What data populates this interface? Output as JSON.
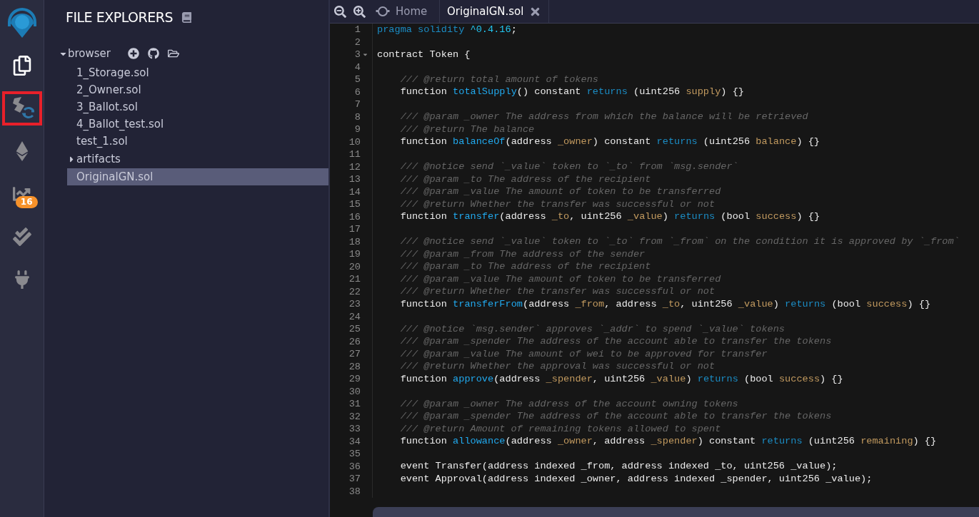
{
  "sidebar": {
    "items": [
      {
        "kind": "files",
        "selected": true,
        "highlighted": false
      },
      {
        "kind": "compiler",
        "selected": false,
        "highlighted": true
      },
      {
        "kind": "deploy",
        "selected": false,
        "highlighted": false
      },
      {
        "kind": "analysis",
        "selected": false,
        "highlighted": false,
        "badge": "16"
      },
      {
        "kind": "tests",
        "selected": false,
        "highlighted": false
      },
      {
        "kind": "plugins",
        "selected": false,
        "highlighted": false
      }
    ]
  },
  "explorer": {
    "title": "FILE EXPLORERS",
    "tree": [
      {
        "kind": "folder",
        "name": "browser",
        "expanded": true,
        "selected": false,
        "children": [
          {
            "kind": "file",
            "name": "1_Storage.sol",
            "selected": false
          },
          {
            "kind": "file",
            "name": "2_Owner.sol",
            "selected": false
          },
          {
            "kind": "file",
            "name": "3_Ballot.sol",
            "selected": false
          },
          {
            "kind": "file",
            "name": "4_Ballot_test.sol",
            "selected": false
          },
          {
            "kind": "file",
            "name": "test_1.sol",
            "selected": false
          },
          {
            "kind": "folder",
            "name": "artifacts",
            "expanded": false,
            "selected": false
          },
          {
            "kind": "file",
            "name": "OriginalGN.sol",
            "selected": true
          }
        ]
      }
    ]
  },
  "tabs": [
    {
      "kind": "home",
      "label": "Home",
      "selected": false
    },
    {
      "kind": "file",
      "label": "OriginalGN.sol",
      "selected": true
    }
  ],
  "editor": {
    "lines": [
      {
        "number": "1",
        "tokens": [
          {
            "kind": "keyword",
            "text": "pragma solidity"
          },
          {
            "kind": "number",
            "text": " ^0.4.16"
          },
          {
            "kind": "plain",
            "text": ";"
          }
        ]
      },
      {
        "number": "2"
      },
      {
        "number": "3",
        "fold": {
          "expanded": true
        },
        "tokens": [
          {
            "kind": "plain",
            "text": "contract Token {"
          }
        ]
      },
      {
        "number": "4"
      },
      {
        "number": "5",
        "tokens": [
          {
            "kind": "comment",
            "text": "    /// @return total amount of tokens"
          }
        ]
      },
      {
        "number": "6",
        "tokens": [
          {
            "kind": "plain",
            "text": "    function "
          },
          {
            "kind": "function",
            "text": "totalSupply"
          },
          {
            "kind": "plain",
            "text": "() constant "
          },
          {
            "kind": "keyword",
            "text": "returns"
          },
          {
            "kind": "plain",
            "text": " (uint256 "
          },
          {
            "kind": "param",
            "text": "supply"
          },
          {
            "kind": "plain",
            "text": ") {}"
          }
        ]
      },
      {
        "number": "7"
      },
      {
        "number": "8",
        "tokens": [
          {
            "kind": "comment",
            "text": "    /// @param _owner The address from which the balance will be retrieved"
          }
        ]
      },
      {
        "number": "9",
        "tokens": [
          {
            "kind": "comment",
            "text": "    /// @return The balance"
          }
        ]
      },
      {
        "number": "10",
        "tokens": [
          {
            "kind": "plain",
            "text": "    function "
          },
          {
            "kind": "function",
            "text": "balanceOf"
          },
          {
            "kind": "plain",
            "text": "(address "
          },
          {
            "kind": "param",
            "text": "_owner"
          },
          {
            "kind": "plain",
            "text": ") constant "
          },
          {
            "kind": "keyword",
            "text": "returns"
          },
          {
            "kind": "plain",
            "text": " (uint256 "
          },
          {
            "kind": "param",
            "text": "balance"
          },
          {
            "kind": "plain",
            "text": ") {}"
          }
        ]
      },
      {
        "number": "11"
      },
      {
        "number": "12",
        "tokens": [
          {
            "kind": "comment",
            "text": "    /// @notice send `_value` token to `_to` from `msg.sender`"
          }
        ]
      },
      {
        "number": "13",
        "tokens": [
          {
            "kind": "comment",
            "text": "    /// @param _to The address of the recipient"
          }
        ]
      },
      {
        "number": "14",
        "tokens": [
          {
            "kind": "comment",
            "text": "    /// @param _value The amount of token to be transferred"
          }
        ]
      },
      {
        "number": "15",
        "tokens": [
          {
            "kind": "comment",
            "text": "    /// @return Whether the transfer was successful or not"
          }
        ]
      },
      {
        "number": "16",
        "tokens": [
          {
            "kind": "plain",
            "text": "    function "
          },
          {
            "kind": "function",
            "text": "transfer"
          },
          {
            "kind": "plain",
            "text": "(address "
          },
          {
            "kind": "param",
            "text": "_to"
          },
          {
            "kind": "plain",
            "text": ", uint256 "
          },
          {
            "kind": "param",
            "text": "_value"
          },
          {
            "kind": "plain",
            "text": ") "
          },
          {
            "kind": "keyword",
            "text": "returns"
          },
          {
            "kind": "plain",
            "text": " (bool "
          },
          {
            "kind": "param",
            "text": "success"
          },
          {
            "kind": "plain",
            "text": ") {}"
          }
        ]
      },
      {
        "number": "17"
      },
      {
        "number": "18",
        "tokens": [
          {
            "kind": "comment",
            "text": "    /// @notice send `_value` token to `_to` from `_from` on the condition it is approved by `_from`"
          }
        ]
      },
      {
        "number": "19",
        "tokens": [
          {
            "kind": "comment",
            "text": "    /// @param _from The address of the sender"
          }
        ]
      },
      {
        "number": "20",
        "tokens": [
          {
            "kind": "comment",
            "text": "    /// @param _to The address of the recipient"
          }
        ]
      },
      {
        "number": "21",
        "tokens": [
          {
            "kind": "comment",
            "text": "    /// @param _value The amount of token to be transferred"
          }
        ]
      },
      {
        "number": "22",
        "tokens": [
          {
            "kind": "comment",
            "text": "    /// @return Whether the transfer was successful or not"
          }
        ]
      },
      {
        "number": "23",
        "tokens": [
          {
            "kind": "plain",
            "text": "    function "
          },
          {
            "kind": "function",
            "text": "transferFrom"
          },
          {
            "kind": "plain",
            "text": "(address "
          },
          {
            "kind": "param",
            "text": "_from"
          },
          {
            "kind": "plain",
            "text": ", address "
          },
          {
            "kind": "param",
            "text": "_to"
          },
          {
            "kind": "plain",
            "text": ", uint256 "
          },
          {
            "kind": "param",
            "text": "_value"
          },
          {
            "kind": "plain",
            "text": ") "
          },
          {
            "kind": "keyword",
            "text": "returns"
          },
          {
            "kind": "plain",
            "text": " (bool "
          },
          {
            "kind": "param",
            "text": "success"
          },
          {
            "kind": "plain",
            "text": ") {}"
          }
        ]
      },
      {
        "number": "24"
      },
      {
        "number": "25",
        "tokens": [
          {
            "kind": "comment",
            "text": "    /// @notice `msg.sender` approves `_addr` to spend `_value` tokens"
          }
        ]
      },
      {
        "number": "26",
        "tokens": [
          {
            "kind": "comment",
            "text": "    /// @param _spender The address of the account able to transfer the tokens"
          }
        ]
      },
      {
        "number": "27",
        "tokens": [
          {
            "kind": "comment",
            "text": "    /// @param _value The amount of wei to be approved for transfer"
          }
        ]
      },
      {
        "number": "28",
        "tokens": [
          {
            "kind": "comment",
            "text": "    /// @return Whether the approval was successful or not"
          }
        ]
      },
      {
        "number": "29",
        "tokens": [
          {
            "kind": "plain",
            "text": "    function "
          },
          {
            "kind": "function",
            "text": "approve"
          },
          {
            "kind": "plain",
            "text": "(address "
          },
          {
            "kind": "param",
            "text": "_spender"
          },
          {
            "kind": "plain",
            "text": ", uint256 "
          },
          {
            "kind": "param",
            "text": "_value"
          },
          {
            "kind": "plain",
            "text": ") "
          },
          {
            "kind": "keyword",
            "text": "returns"
          },
          {
            "kind": "plain",
            "text": " (bool "
          },
          {
            "kind": "param",
            "text": "success"
          },
          {
            "kind": "plain",
            "text": ") {}"
          }
        ]
      },
      {
        "number": "30"
      },
      {
        "number": "31",
        "tokens": [
          {
            "kind": "comment",
            "text": "    /// @param _owner The address of the account owning tokens"
          }
        ]
      },
      {
        "number": "32",
        "tokens": [
          {
            "kind": "comment",
            "text": "    /// @param _spender The address of the account able to transfer the tokens"
          }
        ]
      },
      {
        "number": "33",
        "tokens": [
          {
            "kind": "comment",
            "text": "    /// @return Amount of remaining tokens allowed to spent"
          }
        ]
      },
      {
        "number": "34",
        "tokens": [
          {
            "kind": "plain",
            "text": "    function "
          },
          {
            "kind": "function",
            "text": "allowance"
          },
          {
            "kind": "plain",
            "text": "(address "
          },
          {
            "kind": "param",
            "text": "_owner"
          },
          {
            "kind": "plain",
            "text": ", address "
          },
          {
            "kind": "param",
            "text": "_spender"
          },
          {
            "kind": "plain",
            "text": ") constant "
          },
          {
            "kind": "keyword",
            "text": "returns"
          },
          {
            "kind": "plain",
            "text": " (uint256 "
          },
          {
            "kind": "param",
            "text": "remaining"
          },
          {
            "kind": "plain",
            "text": ") {}"
          }
        ]
      },
      {
        "number": "35"
      },
      {
        "number": "36",
        "tokens": [
          {
            "kind": "plain",
            "text": "    event Transfer(address indexed _from, address indexed _to, uint256 _value);"
          }
        ]
      },
      {
        "number": "37",
        "tokens": [
          {
            "kind": "plain",
            "text": "    event Approval(address indexed _owner, address indexed _spender, uint256 _value);"
          }
        ]
      },
      {
        "number": "38"
      }
    ]
  }
}
